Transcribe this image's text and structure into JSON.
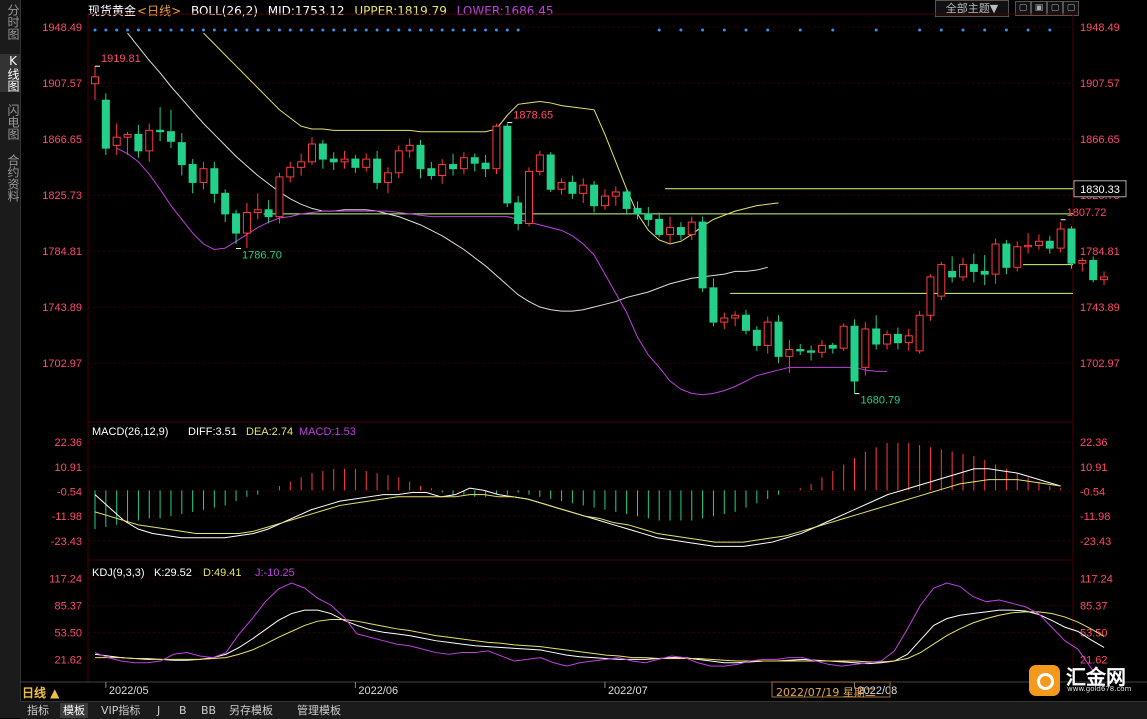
{
  "side_tabs": [
    {
      "label": "分时图",
      "active": false
    },
    {
      "label": "K线图",
      "active": true
    },
    {
      "label": "闪电图",
      "active": false
    },
    {
      "label": "合约资料",
      "active": false
    }
  ],
  "header": {
    "symbol": "现货黄金",
    "period_tag": "<日线>",
    "boll_label": "BOLL(26,2)",
    "mid_label": "MID:1753.12",
    "upper_label": "UPPER:1819.79",
    "lower_label": "LOWER:1686.45",
    "theme_select": "全部主题▼",
    "window_buttons": [
      "▢",
      "▣",
      "▢",
      "▢"
    ]
  },
  "colors": {
    "up": "#ff3b3b",
    "down": "#22d08a",
    "mid": "#dddddd",
    "upper": "#e6e26a",
    "lower": "#c040e0",
    "hline": "#c8ff7a",
    "axis_text": "#ff4a6a",
    "grid": "#3a0000"
  },
  "chart_data": [
    {
      "type": "candlestick",
      "title": "现货黄金 日线",
      "ylim": [
        1663,
        1955
      ],
      "yticks": [
        "1948.49",
        "1907.57",
        "1866.65",
        "1825.73",
        "1784.81",
        "1743.89",
        "1702.97"
      ],
      "ytick_values": [
        1948.49,
        1907.57,
        1866.65,
        1825.73,
        1784.81,
        1743.89,
        1702.97
      ],
      "xtick_labels": [
        "2022/05",
        "2022/06",
        "2022/07",
        "2022/08"
      ],
      "xtick_index": [
        1,
        24,
        47,
        70
      ],
      "hover_date": "2022/07/19 星期二",
      "candles": [
        [
          1907,
          1912,
          1920,
          1895
        ],
        [
          1895,
          1860,
          1900,
          1855
        ],
        [
          1862,
          1868,
          1878,
          1855
        ],
        [
          1868,
          1870,
          1872,
          1855
        ],
        [
          1870,
          1858,
          1877,
          1853
        ],
        [
          1858,
          1873,
          1878,
          1850
        ],
        [
          1873,
          1872,
          1890,
          1865
        ],
        [
          1872,
          1865,
          1888,
          1860
        ],
        [
          1864,
          1848,
          1871,
          1840
        ],
        [
          1848,
          1835,
          1852,
          1827
        ],
        [
          1835,
          1845,
          1850,
          1830
        ],
        [
          1845,
          1827,
          1850,
          1820
        ],
        [
          1827,
          1812,
          1830,
          1806
        ],
        [
          1812,
          1798,
          1815,
          1790
        ],
        [
          1798,
          1813,
          1820,
          1787
        ],
        [
          1813,
          1815,
          1827,
          1808
        ],
        [
          1815,
          1810,
          1822,
          1805
        ],
        [
          1810,
          1839,
          1842,
          1805
        ],
        [
          1839,
          1846,
          1850,
          1835
        ],
        [
          1846,
          1850,
          1856,
          1840
        ],
        [
          1850,
          1863,
          1868,
          1848
        ],
        [
          1863,
          1852,
          1866,
          1845
        ],
        [
          1852,
          1850,
          1857,
          1844
        ],
        [
          1850,
          1852,
          1858,
          1845
        ],
        [
          1852,
          1846,
          1855,
          1842
        ],
        [
          1846,
          1852,
          1856,
          1843
        ],
        [
          1852,
          1835,
          1858,
          1830
        ],
        [
          1835,
          1842,
          1846,
          1827
        ],
        [
          1842,
          1858,
          1862,
          1838
        ],
        [
          1858,
          1862,
          1867,
          1853
        ],
        [
          1862,
          1845,
          1866,
          1838
        ],
        [
          1845,
          1840,
          1850,
          1837
        ],
        [
          1840,
          1848,
          1852,
          1834
        ],
        [
          1848,
          1845,
          1856,
          1840
        ],
        [
          1845,
          1853,
          1857,
          1841
        ],
        [
          1853,
          1849,
          1856,
          1843
        ],
        [
          1849,
          1845,
          1855,
          1839
        ],
        [
          1845,
          1876,
          1878,
          1841
        ],
        [
          1876,
          1820,
          1878,
          1817
        ],
        [
          1820,
          1805,
          1825,
          1800
        ],
        [
          1805,
          1843,
          1846,
          1803
        ],
        [
          1843,
          1855,
          1858,
          1840
        ],
        [
          1855,
          1830,
          1857,
          1828
        ],
        [
          1830,
          1835,
          1838,
          1826
        ],
        [
          1835,
          1827,
          1840,
          1823
        ],
        [
          1827,
          1833,
          1838,
          1820
        ],
        [
          1833,
          1818,
          1836,
          1813
        ],
        [
          1818,
          1825,
          1830,
          1815
        ],
        [
          1825,
          1828,
          1832,
          1818
        ],
        [
          1828,
          1816,
          1830,
          1812
        ],
        [
          1816,
          1812,
          1821,
          1808
        ],
        [
          1812,
          1808,
          1817,
          1803
        ],
        [
          1808,
          1797,
          1813,
          1795
        ],
        [
          1797,
          1802,
          1810,
          1790
        ],
        [
          1802,
          1797,
          1806,
          1793
        ],
        [
          1797,
          1806,
          1810,
          1793
        ],
        [
          1806,
          1758,
          1810,
          1755
        ],
        [
          1758,
          1733,
          1765,
          1730
        ],
        [
          1733,
          1736,
          1740,
          1728
        ],
        [
          1736,
          1738,
          1741,
          1730
        ],
        [
          1738,
          1727,
          1742,
          1724
        ],
        [
          1727,
          1716,
          1730,
          1712
        ],
        [
          1716,
          1733,
          1737,
          1710
        ],
        [
          1733,
          1708,
          1738,
          1703
        ],
        [
          1708,
          1713,
          1720,
          1696
        ],
        [
          1713,
          1712,
          1717,
          1709
        ],
        [
          1712,
          1711,
          1716,
          1705
        ],
        [
          1711,
          1716,
          1720,
          1707
        ],
        [
          1716,
          1714,
          1718,
          1710
        ],
        [
          1714,
          1730,
          1732,
          1712
        ],
        [
          1730,
          1690,
          1735,
          1681
        ],
        [
          1700,
          1728,
          1733,
          1694
        ],
        [
          1728,
          1717,
          1738,
          1713
        ],
        [
          1717,
          1724,
          1727,
          1713
        ],
        [
          1724,
          1718,
          1729,
          1713
        ],
        [
          1718,
          1723,
          1728,
          1712
        ],
        [
          1712,
          1738,
          1741,
          1710
        ],
        [
          1738,
          1766,
          1768,
          1734
        ],
        [
          1752,
          1775,
          1777,
          1749
        ],
        [
          1770,
          1766,
          1781,
          1762
        ],
        [
          1766,
          1775,
          1780,
          1763
        ],
        [
          1775,
          1770,
          1783,
          1762
        ],
        [
          1770,
          1768,
          1782,
          1760
        ],
        [
          1768,
          1790,
          1794,
          1761
        ],
        [
          1790,
          1773,
          1793,
          1768
        ],
        [
          1773,
          1788,
          1792,
          1770
        ],
        [
          1788,
          1789,
          1798,
          1783
        ],
        [
          1789,
          1792,
          1797,
          1786
        ],
        [
          1792,
          1787,
          1796,
          1783
        ],
        [
          1787,
          1801,
          1806,
          1784
        ],
        [
          1801,
          1776,
          1803,
          1772
        ],
        [
          1776,
          1778,
          1780,
          1770
        ],
        [
          1778,
          1764,
          1781,
          1762
        ],
        [
          1764,
          1766,
          1770,
          1760
        ]
      ],
      "boll_mid": [
        1944,
        1934,
        1924,
        1915,
        1905,
        1896,
        1887,
        1878,
        1870,
        1862,
        1854,
        1847,
        1840,
        1834,
        1828,
        1823,
        1819,
        1816,
        1814,
        1814,
        1815,
        1815,
        1815,
        1814,
        1812,
        1810,
        1807,
        1804,
        1800,
        1796,
        1791,
        1786,
        1780,
        1774,
        1767,
        1760,
        1753,
        1748,
        1744,
        1742,
        1741,
        1741,
        1742,
        1744,
        1746,
        1748,
        1751,
        1753,
        1755,
        1758,
        1761,
        1763,
        1765,
        1766,
        1767,
        1768,
        1770,
        1770,
        1771,
        1773
      ],
      "boll_mid_x_index": 3,
      "boll_upper": [
        1944,
        1936,
        1928,
        1920,
        1912,
        1904,
        1896,
        1888,
        1882,
        1876,
        1874,
        1874,
        1873,
        1873,
        1873,
        1873,
        1873,
        1873,
        1873,
        1873,
        1872,
        1872,
        1872,
        1872,
        1872,
        1872,
        1872,
        1874,
        1884,
        1892,
        1893,
        1894,
        1893,
        1891,
        1890,
        1889,
        1888,
        1870,
        1850,
        1830,
        1812,
        1800,
        1793,
        1790,
        1792,
        1797,
        1803,
        1808,
        1811,
        1814,
        1816,
        1818,
        1819,
        1820
      ],
      "boll_upper_x_index": 10,
      "boll_lower": [
        1860,
        1856,
        1850,
        1841,
        1830,
        1818,
        1808,
        1798,
        1790,
        1786,
        1787,
        1792,
        1797,
        1802,
        1806,
        1809,
        1810,
        1812,
        1813,
        1814,
        1814,
        1814,
        1814,
        1814,
        1814,
        1814,
        1813,
        1812,
        1811,
        1810,
        1810,
        1810,
        1810,
        1810,
        1810,
        1810,
        1810,
        1808,
        1806,
        1804,
        1802,
        1800,
        1796,
        1790,
        1782,
        1768,
        1754,
        1740,
        1722,
        1709,
        1700,
        1690,
        1684,
        1681,
        1680,
        1681,
        1683,
        1686,
        1690,
        1694,
        1696,
        1698,
        1700,
        1700,
        1700,
        1700,
        1700,
        1700,
        1700,
        1698,
        1697,
        1697
      ],
      "boll_lower_x_index": 2,
      "hlines": [
        {
          "y": 1830.33,
          "from": 53,
          "label": "1830.33"
        },
        {
          "y": 1812,
          "from": 16
        },
        {
          "y": 1775,
          "from": 86
        },
        {
          "y": 1754,
          "from": 59
        }
      ],
      "annotations": [
        {
          "text": "1919.81",
          "y": 1919.81,
          "index": 0,
          "color": "#ff4a6a"
        },
        {
          "text": "1786.70",
          "y": 1786.7,
          "index": 13,
          "color": "#22d08a"
        },
        {
          "text": "1878.65",
          "y": 1878.65,
          "index": 38,
          "color": "#ff4a6a"
        },
        {
          "text": "1680.79",
          "y": 1680.79,
          "index": 70,
          "color": "#22d08a"
        },
        {
          "text": "1807.72",
          "y": 1807.72,
          "index": 89,
          "color": "#ff4a6a"
        }
      ]
    },
    {
      "type": "macd",
      "title": "MACD(26,12,9)",
      "diff_label": "DIFF:3.51",
      "dea_label": "DEA:2.74",
      "macd_label": "MACD:1.53",
      "ylim": [
        -30,
        28
      ],
      "yticks": [
        "22.36",
        "10.91",
        "-0.54",
        "-11.98",
        "-23.43"
      ],
      "ytick_values": [
        22.36,
        10.91,
        -0.54,
        -11.98,
        -23.43
      ],
      "hist": [
        -18,
        -17,
        -16,
        -15,
        -14,
        -13,
        -13,
        -12,
        -11,
        -10,
        -9,
        -8,
        -7,
        -5,
        -3,
        -2,
        0,
        2,
        4,
        6,
        8,
        9,
        10,
        10,
        10,
        9,
        8,
        7,
        6,
        4,
        2,
        1,
        -1,
        -2,
        -2,
        -3,
        -3,
        -2,
        -2,
        -1,
        -2,
        -3,
        -4,
        -5,
        -6,
        -7,
        -8,
        -9,
        -10,
        -11,
        -12,
        -13,
        -14,
        -14,
        -14,
        -14,
        -13,
        -12,
        -11,
        -10,
        -8,
        -6,
        -4,
        -2,
        0,
        1,
        3,
        6,
        9,
        12,
        15,
        18,
        20,
        22,
        22,
        22,
        21,
        20,
        19,
        18,
        17,
        16,
        14,
        12,
        10,
        8,
        6,
        4,
        2,
        1
      ],
      "diff": [
        -2,
        -8,
        -14,
        -18,
        -20,
        -21,
        -22,
        -22,
        -22,
        -22,
        -21,
        -20,
        -18,
        -15,
        -12,
        -9,
        -7,
        -5,
        -4,
        -3,
        -2,
        -2,
        -1,
        -1,
        -3,
        -2,
        1,
        0,
        -2,
        -3,
        -4,
        -6,
        -8,
        -10,
        -12,
        -14,
        -16,
        -18,
        -20,
        -22,
        -23,
        -24,
        -25,
        -26,
        -26,
        -26,
        -25,
        -24,
        -22,
        -20,
        -17,
        -14,
        -11,
        -8,
        -5,
        -2,
        0,
        2,
        4,
        6,
        8,
        10,
        10,
        9,
        8,
        6,
        4,
        2
      ],
      "dea": [
        -10,
        -12,
        -14,
        -16,
        -17,
        -18,
        -19,
        -20,
        -20,
        -20,
        -20,
        -19,
        -17,
        -15,
        -13,
        -11,
        -9,
        -7,
        -6,
        -5,
        -4,
        -3,
        -3,
        -3,
        -3,
        -3,
        -2,
        -2,
        -3,
        -3,
        -4,
        -6,
        -8,
        -10,
        -12,
        -13,
        -15,
        -16,
        -18,
        -20,
        -21,
        -22,
        -23,
        -24,
        -24,
        -24,
        -23,
        -22,
        -21,
        -19,
        -17,
        -15,
        -13,
        -11,
        -9,
        -7,
        -5,
        -3,
        -1,
        1,
        3,
        4,
        5,
        5,
        5,
        4,
        3,
        2
      ]
    },
    {
      "type": "kdj",
      "title": "KDJ(9,3,3)",
      "k_label": "K:29.52",
      "d_label": "D:49.41",
      "j_label": "J:-10.25",
      "ylim": [
        0,
        125
      ],
      "yticks": [
        "117.24",
        "85.37",
        "53.50",
        "21.62"
      ],
      "ytick_values": [
        117.24,
        85.37,
        53.5,
        21.62
      ],
      "k": [
        28,
        26,
        24,
        23,
        22,
        22,
        21,
        21,
        22,
        24,
        28,
        36,
        46,
        57,
        68,
        76,
        80,
        80,
        76,
        68,
        62,
        57,
        54,
        52,
        50,
        47,
        44,
        42,
        40,
        38,
        37,
        36,
        35,
        34,
        33,
        30,
        27,
        25,
        24,
        23,
        22,
        22,
        22,
        23,
        24,
        24,
        22,
        20,
        18,
        18,
        19,
        20,
        20,
        21,
        22,
        21,
        20,
        19,
        18,
        17,
        18,
        20,
        28,
        45,
        62,
        70,
        74,
        76,
        78,
        80,
        80,
        79,
        75,
        68,
        60,
        55,
        45,
        36
      ],
      "d": [
        24,
        24,
        24,
        23,
        23,
        22,
        22,
        22,
        22,
        23,
        24,
        28,
        33,
        40,
        48,
        55,
        62,
        67,
        69,
        69,
        67,
        64,
        61,
        58,
        56,
        53,
        50,
        48,
        46,
        44,
        42,
        41,
        39,
        38,
        37,
        35,
        33,
        31,
        29,
        27,
        26,
        24,
        24,
        23,
        23,
        23,
        23,
        22,
        21,
        20,
        20,
        20,
        20,
        20,
        20,
        20,
        20,
        20,
        20,
        19,
        19,
        20,
        23,
        30,
        40,
        50,
        58,
        65,
        70,
        74,
        77,
        78,
        78,
        76,
        72,
        66,
        58,
        49
      ],
      "j": [
        30,
        24,
        20,
        18,
        18,
        20,
        28,
        30,
        26,
        24,
        30,
        52,
        70,
        90,
        105,
        112,
        106,
        94,
        86,
        72,
        52,
        48,
        44,
        40,
        38,
        34,
        30,
        28,
        30,
        30,
        32,
        26,
        20,
        22,
        24,
        18,
        14,
        18,
        20,
        22,
        24,
        20,
        18,
        22,
        26,
        24,
        18,
        14,
        14,
        16,
        20,
        22,
        22,
        24,
        24,
        20,
        16,
        14,
        16,
        18,
        20,
        32,
        58,
        86,
        106,
        112,
        108,
        96,
        90,
        92,
        88,
        84,
        76,
        60,
        44,
        34,
        12,
        -10
      ]
    }
  ],
  "bottom": {
    "period": "日线 ▲",
    "tabs": [
      "指标",
      "模板",
      "VIP指标",
      "J",
      "B",
      "BB",
      "另存模板",
      "管理模板"
    ],
    "active_tab": "模板",
    "logo_name": "汇金网",
    "logo_url": "www.gold678.com"
  }
}
